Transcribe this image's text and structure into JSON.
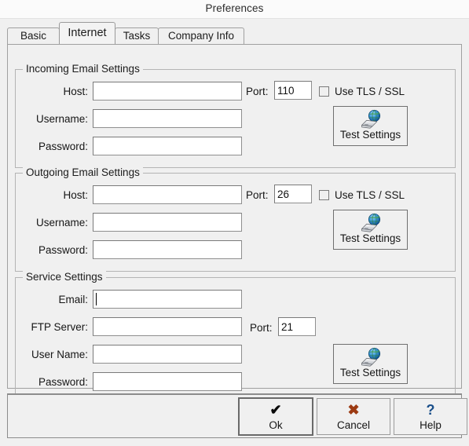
{
  "window": {
    "title": "Preferences"
  },
  "tabs": [
    {
      "label": "Basic",
      "active": false
    },
    {
      "label": "Internet",
      "active": true
    },
    {
      "label": "Tasks",
      "active": false
    },
    {
      "label": "Company Info",
      "active": false
    }
  ],
  "groups": {
    "incoming": {
      "title": "Incoming Email Settings",
      "fields": [
        {
          "label": "Host:",
          "value": ""
        },
        {
          "label": "Username:",
          "value": ""
        },
        {
          "label": "Password:",
          "value": ""
        }
      ],
      "port": {
        "label": "Port:",
        "value": "110"
      },
      "tls": {
        "label": "Use TLS / SSL",
        "checked": false
      },
      "test": {
        "label": "Test Settings",
        "icon": "globe-network-icon"
      }
    },
    "outgoing": {
      "title": "Outgoing Email Settings",
      "fields": [
        {
          "label": "Host:",
          "value": ""
        },
        {
          "label": "Username:",
          "value": ""
        },
        {
          "label": "Password:",
          "value": ""
        }
      ],
      "port": {
        "label": "Port:",
        "value": "26"
      },
      "tls": {
        "label": "Use TLS / SSL",
        "checked": false
      },
      "test": {
        "label": "Test Settings",
        "icon": "globe-network-icon"
      }
    },
    "service": {
      "title": "Service Settings",
      "fields": [
        {
          "label": "Email:",
          "value": "",
          "focused": true
        },
        {
          "label": "FTP Server:",
          "value": ""
        },
        {
          "label": "User Name:",
          "value": ""
        },
        {
          "label": "Password:",
          "value": ""
        }
      ],
      "port": {
        "label": "Port:",
        "value": "21"
      },
      "test": {
        "label": "Test Settings",
        "icon": "globe-network-icon"
      }
    }
  },
  "buttons": {
    "ok": {
      "label": "Ok",
      "icon": "checkmark-icon",
      "glyph": "✔",
      "color": "#0a0a0a",
      "default": true
    },
    "cancel": {
      "label": "Cancel",
      "icon": "cross-icon",
      "glyph": "✖",
      "color": "#9c3a12",
      "default": false
    },
    "help": {
      "label": "Help",
      "icon": "question-mark-icon",
      "glyph": "?",
      "color": "#1a4f8a",
      "default": false
    }
  },
  "colors": {
    "dialog_background": "#f0f0f0",
    "titlebar_background": "#fbfbfb",
    "field_background": "#ffffff",
    "border": "#a0a0a0",
    "group_border": "#b4b4b4"
  }
}
